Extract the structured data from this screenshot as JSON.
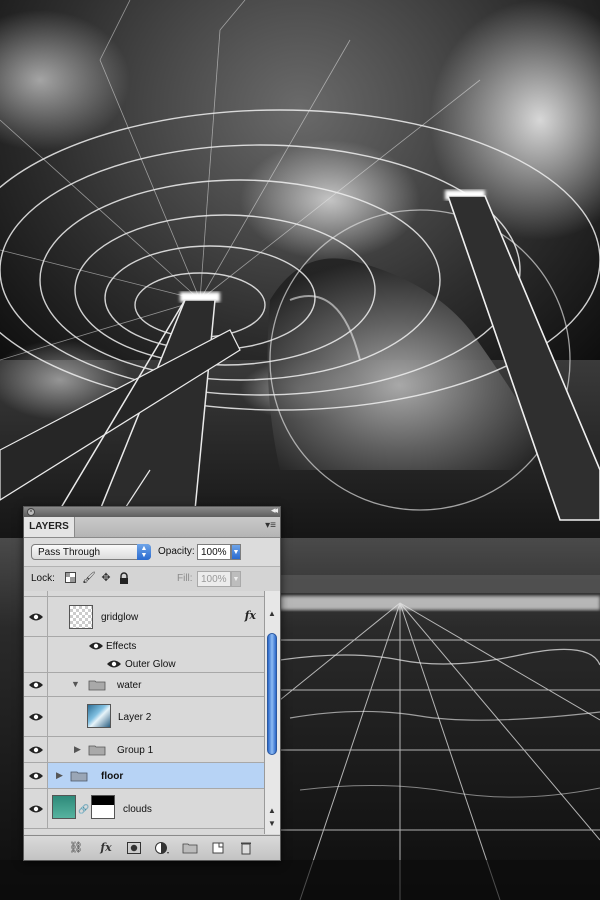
{
  "panel": {
    "tab_label": "LAYERS",
    "blend_mode": "Pass Through",
    "opacity_label": "Opacity:",
    "opacity_value": "100%",
    "lock_label": "Lock:",
    "fill_label": "Fill:",
    "fill_value": "100%"
  },
  "layers": [
    {
      "name": "gridglow",
      "type": "layer",
      "visible": true,
      "has_fx": true
    },
    {
      "name": "Effects",
      "type": "effects-header",
      "visible": true
    },
    {
      "name": "Outer Glow",
      "type": "effect",
      "visible": true
    },
    {
      "name": "water",
      "type": "group",
      "visible": true,
      "expanded": true
    },
    {
      "name": "Layer 2",
      "type": "layer",
      "visible": true
    },
    {
      "name": "Group 1",
      "type": "group",
      "visible": true,
      "expanded": false
    },
    {
      "name": "floor",
      "type": "group",
      "visible": true,
      "expanded": false,
      "selected": true
    },
    {
      "name": "clouds",
      "type": "layer-with-mask",
      "visible": true
    }
  ],
  "icons": {
    "fx_glyph": "fx",
    "lock_transparent": "checker-icon",
    "lock_image": "brush-icon",
    "lock_position": "move-icon",
    "lock_all": "padlock-icon"
  },
  "colors": {
    "panel_bg": "#d6d6d6",
    "selected_row": "#b7d3f5",
    "accent_blue": "#2a6bd0"
  }
}
